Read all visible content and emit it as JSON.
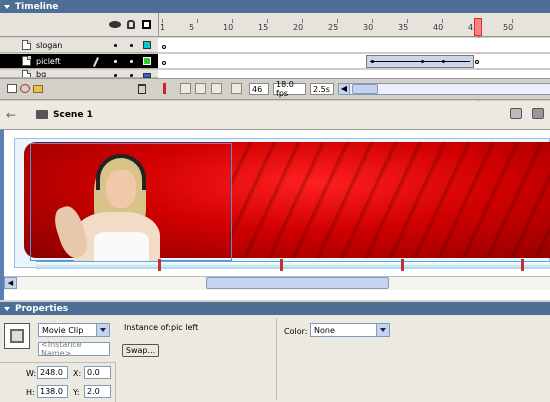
{
  "timeline": {
    "title": "Timeline",
    "layers": [
      {
        "name": "slogan",
        "color": "#00cccc"
      },
      {
        "name": "picleft",
        "color": "#33cc33"
      },
      {
        "name": "bg",
        "color": "#3366cc"
      }
    ],
    "frame_numbers": [
      "1",
      "5",
      "10",
      "15",
      "20",
      "25",
      "30",
      "35",
      "40",
      "45",
      "50"
    ],
    "current_frame": "46",
    "fps": "18.0 fps",
    "elapsed": "2.5s",
    "playhead_frame": 46
  },
  "edit_bar": {
    "scene_label": "Scene 1"
  },
  "properties": {
    "title": "Properties",
    "symbol_type": "Movie Clip",
    "instance_name_placeholder": "<Instance Name>",
    "instance_of_label": "Instance of:",
    "instance_of_value": "pic left",
    "swap_label": "Swap...",
    "color_label": "Color:",
    "color_value": "None",
    "w_label": "W:",
    "w_value": "248.0",
    "h_label": "H:",
    "h_value": "138.0",
    "x_label": "X:",
    "x_value": "0.0",
    "y_label": "Y:",
    "y_value": "2.0"
  },
  "colors": {
    "panel_header": "#4f6e96",
    "selected_layer": "#000000",
    "playhead": "#ff6666",
    "stage_red": "#d10000"
  }
}
